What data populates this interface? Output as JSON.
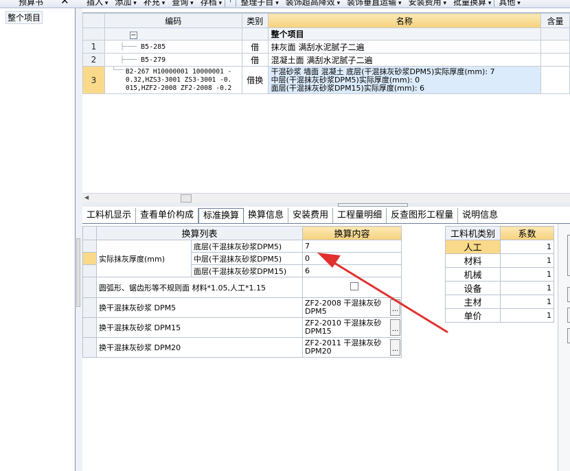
{
  "topbar": {
    "left_tab_label": "预算书",
    "menu": [
      "插入",
      "添加",
      "补充",
      "查询",
      "存档",
      "整理子目",
      "装饰超高降效",
      "装饰垂直运输",
      "安装费用",
      "批量换算",
      "其他"
    ]
  },
  "tree": {
    "root": "整个项目"
  },
  "grid": {
    "headers": {
      "code": "编码",
      "type": "类别",
      "name": "名称",
      "qty": "含量"
    },
    "group_row": {
      "toggle": "−",
      "name": "整个项目"
    },
    "rows": [
      {
        "num": "1",
        "code": "B5-285",
        "type": "借",
        "name": "抹灰面 满刮水泥腻子二遍"
      },
      {
        "num": "2",
        "code": "B5-279",
        "type": "借",
        "name": "混凝土面 满刮水泥腻子二遍"
      },
      {
        "num": "3",
        "code_lines": [
          "B2-267 H10000001 10000001 -",
          "0.32,HZS3-3001 ZS3-3001 -0.",
          "015,HZF2-2008 ZF2-2008 -0.2"
        ],
        "type": "借换",
        "name_lines": [
          "干混砂浆 墙面 混凝土  底层(干混抹灰砂浆DPM5)实际厚度(mm): 7",
          "中层(干混抹灰砂浆DPM5)实际厚度(mm): 0",
          "面层(干混抹灰砂浆DPM15)实际厚度(mm): 6"
        ]
      }
    ]
  },
  "tabs": [
    "工料机显示",
    "查看单价构成",
    "标准换算",
    "换算信息",
    "安装费用",
    "工程量明细",
    "反查图形工程量",
    "说明信息"
  ],
  "active_tab": "标准换算",
  "conversion": {
    "header_list": "换算列表",
    "header_content": "换算内容",
    "thickness_label": "实际抹灰厚度(mm)",
    "layers": [
      {
        "name": "底层(干混抹灰砂浆DPM5)",
        "value": "7"
      },
      {
        "name": "中层(干混抹灰砂浆DPM5)",
        "value": "0"
      },
      {
        "name": "面层(干混抹灰砂浆DPM15)",
        "value": "6"
      }
    ],
    "irregular_label": "圆弧形、锯齿形等不规则面 材料*1.05,人工*1.15",
    "replacements": [
      {
        "label": "换干混抹灰砂浆 DPM5",
        "value_line1": "ZF2-2008  干混抹灰砂",
        "value_line2": "DPM5"
      },
      {
        "label": "换干混抹灰砂浆 DPM15",
        "value_line1": "ZF2-2010  干混抹灰砂",
        "value_line2": "DPM15"
      },
      {
        "label": "换干混抹灰砂浆 DPM20",
        "value_line1": "ZF2-2011  干混抹灰砂",
        "value_line2": "DPM20"
      }
    ],
    "ellipsis": "..."
  },
  "factors": {
    "header_category": "工料机类别",
    "header_factor": "系数",
    "rows": [
      {
        "category": "人工",
        "factor": "1"
      },
      {
        "category": "材料",
        "factor": "1"
      },
      {
        "category": "机械",
        "factor": "1"
      },
      {
        "category": "设备",
        "factor": "1"
      },
      {
        "category": "主材",
        "factor": "1"
      },
      {
        "category": "单价",
        "factor": "1"
      }
    ]
  },
  "colors": {
    "accent_gold": "#f5d17c",
    "selected_row": "#fbd98a",
    "highlight_blue": "#dcebfb",
    "arrow_red": "#e0312f"
  }
}
